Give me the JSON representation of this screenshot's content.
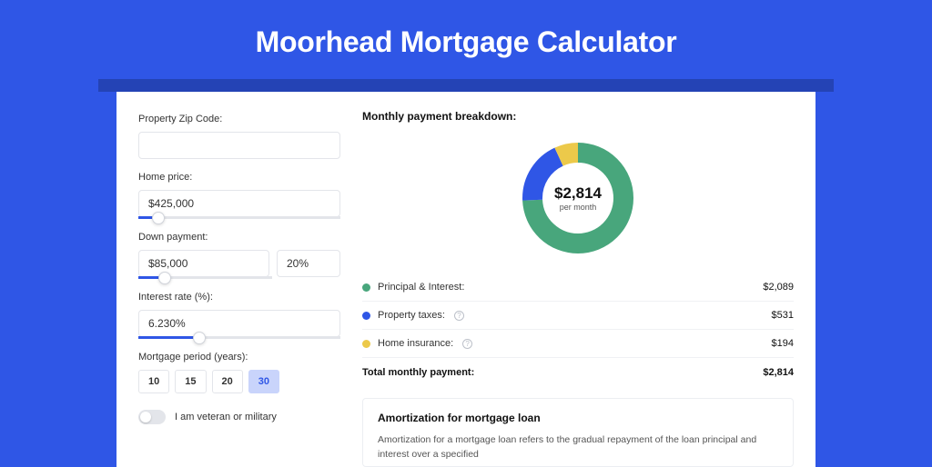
{
  "title": "Moorhead Mortgage Calculator",
  "form": {
    "zip": {
      "label": "Property Zip Code:",
      "value": ""
    },
    "home_price": {
      "label": "Home price:",
      "value": "$425,000",
      "slider_pct": 10
    },
    "down_payment": {
      "label": "Down payment:",
      "amount": "$85,000",
      "pct": "20%",
      "slider_pct": 20
    },
    "interest_rate": {
      "label": "Interest rate (%):",
      "value": "6.230%",
      "slider_pct": 30
    },
    "period": {
      "label": "Mortgage period (years):",
      "options": [
        "10",
        "15",
        "20",
        "30"
      ],
      "selected_index": 3
    },
    "veteran": {
      "label": "I am veteran or military",
      "on": false
    }
  },
  "breakdown": {
    "title": "Monthly payment breakdown:",
    "center_amount": "$2,814",
    "center_sub": "per month",
    "items": [
      {
        "label": "Principal & Interest:",
        "value": "$2,089",
        "color": "green",
        "info": false
      },
      {
        "label": "Property taxes:",
        "value": "$531",
        "color": "blue",
        "info": true
      },
      {
        "label": "Home insurance:",
        "value": "$194",
        "color": "yellow",
        "info": true
      }
    ],
    "total_label": "Total monthly payment:",
    "total_value": "$2,814"
  },
  "chart_data": {
    "type": "pie",
    "title": "Monthly payment breakdown",
    "series": [
      {
        "name": "Principal & Interest",
        "value": 2089,
        "color": "#48a67c"
      },
      {
        "name": "Property taxes",
        "value": 531,
        "color": "#2f56e6"
      },
      {
        "name": "Home insurance",
        "value": 194,
        "color": "#ecc94a"
      }
    ],
    "total": 2814
  },
  "amortization": {
    "title": "Amortization for mortgage loan",
    "text": "Amortization for a mortgage loan refers to the gradual repayment of the loan principal and interest over a specified"
  }
}
